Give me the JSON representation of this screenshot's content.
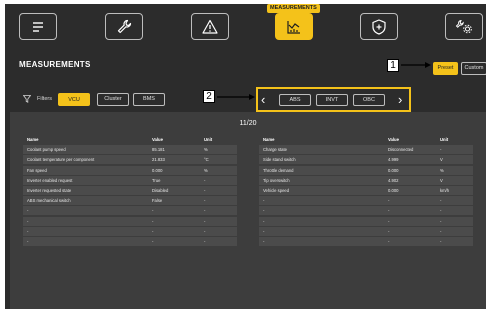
{
  "nav": {
    "active_tab_tag": "MEASUREMENTS",
    "icons": [
      "menu-icon",
      "wrench-icon",
      "warning-icon",
      "measurements-chart-icon",
      "shield-icon",
      "tools-settings-icon"
    ]
  },
  "page": {
    "title": "MEASUREMENTS"
  },
  "mode": {
    "preset": "Preset",
    "custom": "Custom",
    "selected": "Preset"
  },
  "callouts": {
    "one": "1",
    "two": "2"
  },
  "filters": {
    "label": "Filters",
    "options": [
      "VCU",
      "Cluster",
      "BMS"
    ],
    "selected": "VCU"
  },
  "pager": {
    "prev": "‹",
    "next": "›",
    "groups": [
      "ABS",
      "INVT",
      "OBC"
    ]
  },
  "page_indicator": "11/20",
  "left_table": {
    "headers": {
      "name": "Name",
      "value": "Value",
      "unit": "Unit"
    },
    "rows": [
      {
        "name": "Coolant pump speed",
        "value": "85.181",
        "unit": "%"
      },
      {
        "name": "Coolant temperature per component",
        "value": "21.833",
        "unit": "°C"
      },
      {
        "name": "Fan speed",
        "value": "0.000",
        "unit": "%"
      },
      {
        "name": "Inverter enabled request",
        "value": "True",
        "unit": "-"
      },
      {
        "name": "Inverter requested state",
        "value": "Disabled",
        "unit": "-"
      },
      {
        "name": "ABS mechanical switch",
        "value": "False",
        "unit": "-"
      },
      {
        "name": "-",
        "value": "-",
        "unit": "-"
      },
      {
        "name": "-",
        "value": "-",
        "unit": "-"
      },
      {
        "name": "-",
        "value": "-",
        "unit": "-"
      },
      {
        "name": "-",
        "value": "-",
        "unit": "-"
      }
    ]
  },
  "right_table": {
    "headers": {
      "name": "Name",
      "value": "Value",
      "unit": "Unit"
    },
    "rows": [
      {
        "name": "Charge state",
        "value": "Disconnected",
        "unit": "-"
      },
      {
        "name": "Side stand switch",
        "value": "4.999",
        "unit": "V"
      },
      {
        "name": "Throttle demand",
        "value": "0.000",
        "unit": "%"
      },
      {
        "name": "Tip overswitch",
        "value": "4.902",
        "unit": "V"
      },
      {
        "name": "Vehicle speed",
        "value": "0.000",
        "unit": "km/h"
      },
      {
        "name": "-",
        "value": "-",
        "unit": "-"
      },
      {
        "name": "-",
        "value": "-",
        "unit": "-"
      },
      {
        "name": "-",
        "value": "-",
        "unit": "-"
      },
      {
        "name": "-",
        "value": "-",
        "unit": "-"
      },
      {
        "name": "-",
        "value": "-",
        "unit": "-"
      }
    ]
  },
  "colors": {
    "accent": "#f4c21a",
    "background": "#2c2c2c",
    "panel": "#3d3d3d",
    "row": "#4b4b4b"
  }
}
